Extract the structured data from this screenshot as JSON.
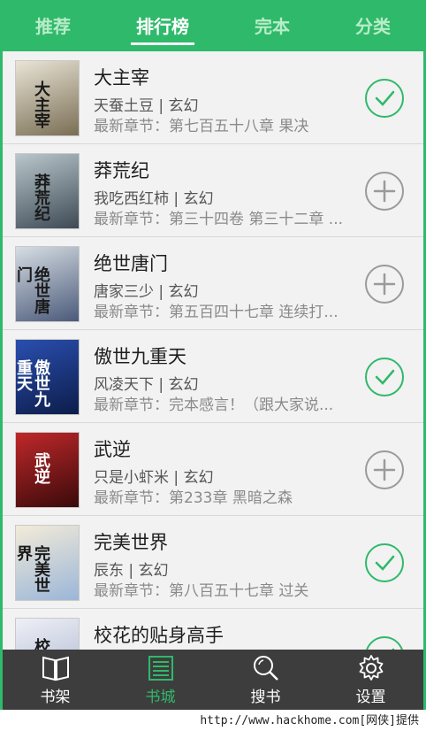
{
  "top_tabs": [
    "推荐",
    "排行榜",
    "完本",
    "分类"
  ],
  "active_top_tab": 1,
  "books": [
    {
      "title": "大主宰",
      "author_genre": "天蚕土豆 | 玄幻",
      "latest": "最新章节：第七百五十八章 果决",
      "status": "added",
      "cover_text": "大主宰",
      "cover_colors": [
        "#e9e4d6",
        "#7a6e54"
      ]
    },
    {
      "title": "莽荒纪",
      "author_genre": "我吃西红柿 | 玄幻",
      "latest": "最新章节：第三十四卷 第三十二章 ...",
      "status": "add",
      "cover_text": "莽荒纪",
      "cover_colors": [
        "#b9c7cc",
        "#3d4a55"
      ]
    },
    {
      "title": "绝世唐门",
      "author_genre": "唐家三少 | 玄幻",
      "latest": "最新章节：第五百四十七章 连续打...",
      "status": "add",
      "cover_text": "绝世唐门",
      "cover_colors": [
        "#d6dde3",
        "#4b5a7a"
      ]
    },
    {
      "title": "傲世九重天",
      "author_genre": "风凌天下 | 玄幻",
      "latest": "最新章节：完本感言！（跟大家说...",
      "status": "added",
      "cover_text": "傲世九重天",
      "cover_colors": [
        "#2a4fb0",
        "#0c1d4a"
      ]
    },
    {
      "title": "武逆",
      "author_genre": "只是小虾米 | 玄幻",
      "latest": "最新章节：第233章 黑暗之森",
      "status": "add",
      "cover_text": "武逆",
      "cover_colors": [
        "#c0282a",
        "#3a0a0a"
      ]
    },
    {
      "title": "完美世界",
      "author_genre": "辰东 | 玄幻",
      "latest": "最新章节：第八百五十七章 过关",
      "status": "added",
      "cover_text": "完美世界",
      "cover_colors": [
        "#f3ebd8",
        "#9ab6d8"
      ]
    },
    {
      "title": "校花的贴身高手",
      "author_genre": "",
      "latest": "",
      "status": "added",
      "cover_text": "校花",
      "cover_colors": [
        "#eef0f6",
        "#a9b3cf"
      ]
    }
  ],
  "bottom_nav": [
    {
      "label": "书架",
      "icon": "book-icon"
    },
    {
      "label": "书城",
      "icon": "bookstore-icon"
    },
    {
      "label": "搜书",
      "icon": "search-icon"
    },
    {
      "label": "设置",
      "icon": "gear-icon"
    }
  ],
  "active_bottom_nav": 1,
  "watermark": "http://www.hackhome.com[网侠]提供",
  "colors": {
    "accent": "#2fb96a",
    "nav_bg": "#3d3d3d"
  }
}
